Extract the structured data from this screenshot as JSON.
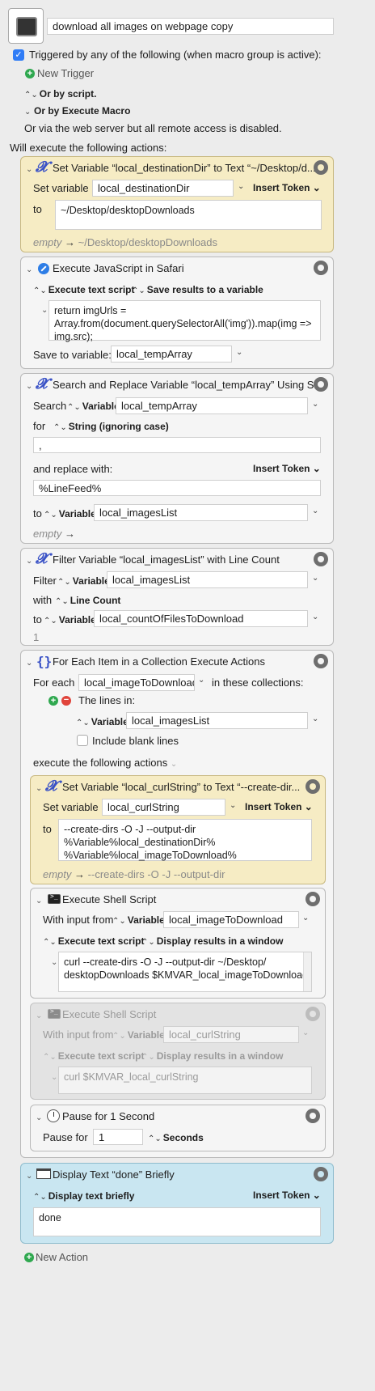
{
  "macro": {
    "name": "download all images on webpage copy",
    "triggered_label": "Triggered by any of the following (when macro group is active):",
    "new_trigger": "New Trigger",
    "or_by_script": "Or by script.",
    "or_by_execute_macro": "Or by Execute Macro",
    "web_server": "Or via the web server but all remote access is disabled.",
    "will_execute": "Will execute the following actions:",
    "new_action": "New Action"
  },
  "a1": {
    "title": "Set Variable “local_destinationDir” to Text “~/Desktop/d...",
    "set_variable_label": "Set variable",
    "variable": "local_destinationDir",
    "insert_token": "Insert Token",
    "to_label": "to",
    "value": "~/Desktop/desktopDownloads",
    "preview_empty": "empty",
    "preview_arrow": "→",
    "preview_value": "~/Desktop/desktopDownloads"
  },
  "a2": {
    "title": "Execute JavaScript in Safari",
    "mode": "Execute text script",
    "save_mode": "Save results to a variable",
    "code_lines": [
      "return imgUrls =",
      "Array.from(document.querySelectorAll('img')).map(img =>",
      "img.src);"
    ],
    "save_label": "Save to variable:",
    "save_variable": "local_tempArray"
  },
  "a3": {
    "title": "Search and Replace Variable “local_tempArray” Using S...",
    "search_label": "Search",
    "variable_label": "Variable",
    "search_variable": "local_tempArray",
    "for_label": "for",
    "match_mode": "String (ignoring case)",
    "search_value": ",",
    "replace_label": "and replace with:",
    "insert_token": "Insert Token",
    "replace_value": "%LineFeed%",
    "to_label": "to",
    "to_variable_label": "Variable",
    "to_variable": "local_imagesList",
    "preview_empty": "empty",
    "preview_arrow": "→"
  },
  "a4": {
    "title": "Filter Variable “local_imagesList” with Line Count",
    "filter_label": "Filter",
    "variable_label": "Variable",
    "filter_variable": "local_imagesList",
    "with_label": "with",
    "filter_mode": "Line Count",
    "to_label": "to",
    "to_variable_label": "Variable",
    "to_variable": "local_countOfFilesToDownload",
    "preview_value": "1"
  },
  "a5": {
    "title": "For Each Item in a Collection Execute Actions",
    "for_each_label": "For each",
    "item_variable": "local_imageToDownload",
    "in_collections": "in these collections:",
    "lines_in": "The lines in:",
    "variable_label": "Variable",
    "collection_variable": "local_imagesList",
    "include_blank": "Include blank lines",
    "execute_label": "execute the following actions"
  },
  "a5a": {
    "title": "Set Variable “local_curlString” to Text “--create-dir...",
    "set_variable_label": "Set variable",
    "variable": "local_curlString",
    "insert_token": "Insert Token",
    "to_label": "to",
    "value_lines": [
      "--create-dirs -O -J --output-dir",
      "%Variable%local_destinationDir%",
      "%Variable%local_imageToDownload%"
    ],
    "preview_empty": "empty",
    "preview_arrow": "→",
    "preview_value": "--create-dirs -O -J --output-dir"
  },
  "a5b": {
    "title": "Execute Shell Script",
    "input_label": "With input from",
    "variable_label": "Variable",
    "input_variable": "local_imageToDownload",
    "mode": "Execute text script",
    "display_mode": "Display results in a window",
    "code_lines": [
      "curl --create-dirs -O -J --output-dir ~/Desktop/",
      "desktopDownloads $KMVAR_local_imageToDownload"
    ]
  },
  "a5c": {
    "title": "Execute Shell Script",
    "input_label": "With input from",
    "variable_label": "Variable",
    "input_variable": "local_curlString",
    "mode": "Execute text script",
    "display_mode": "Display results in a window",
    "code_lines": [
      "curl $KMVAR_local_curlString"
    ]
  },
  "a5d": {
    "title": "Pause for 1 Second",
    "pause_label": "Pause for",
    "value": "1",
    "unit": "Seconds"
  },
  "a6": {
    "title": "Display Text “done” Briefly",
    "mode": "Display text briefly",
    "insert_token": "Insert Token",
    "value": "done"
  },
  "colors": {
    "set_variable_bg": "#f6ecc4",
    "display_bg": "#c9e6f1",
    "disabled_bg": "#e3e3e3",
    "checkbox_accent": "#2f7cf6"
  }
}
